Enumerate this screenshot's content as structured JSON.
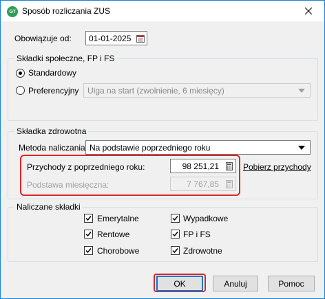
{
  "window": {
    "title": "Sposób rozliczania ZUS",
    "app_icon_text": "GT"
  },
  "valid_from": {
    "label": "Obowiązuje od:",
    "value": "01-01-2025"
  },
  "social": {
    "group_title": "Składki społeczne, FP i FS",
    "option_standard": "Standardowy",
    "option_preferential": "Preferencyjny",
    "preferential_select": "Ulga na start (zwolnienie, 6 miesięcy)",
    "selected": "Standardowy"
  },
  "health": {
    "group_title": "Składka zdrowotna",
    "method_label": "Metoda naliczania",
    "method_value": "Na podstawie poprzedniego roku",
    "revenue_label": "Przychody z poprzedniego roku:",
    "revenue_value": "98 251,21",
    "fetch_link": "Pobierz przychody",
    "base_label": "Podstawa miesięczna:",
    "base_value": "7 767,85"
  },
  "contributions": {
    "group_title": "Naliczane składki",
    "items": [
      {
        "label": "Emerytalne",
        "checked": true
      },
      {
        "label": "Rentowe",
        "checked": true
      },
      {
        "label": "Chorobowe",
        "checked": true
      },
      {
        "label": "Wypadkowe",
        "checked": true
      },
      {
        "label": "FP i FS",
        "checked": true
      },
      {
        "label": "Zdrowotne",
        "checked": true
      }
    ]
  },
  "buttons": {
    "ok": "OK",
    "cancel": "Anuluj",
    "help": "Pomoc"
  },
  "colors": {
    "highlight": "#e02424",
    "accent": "#0078d7"
  }
}
